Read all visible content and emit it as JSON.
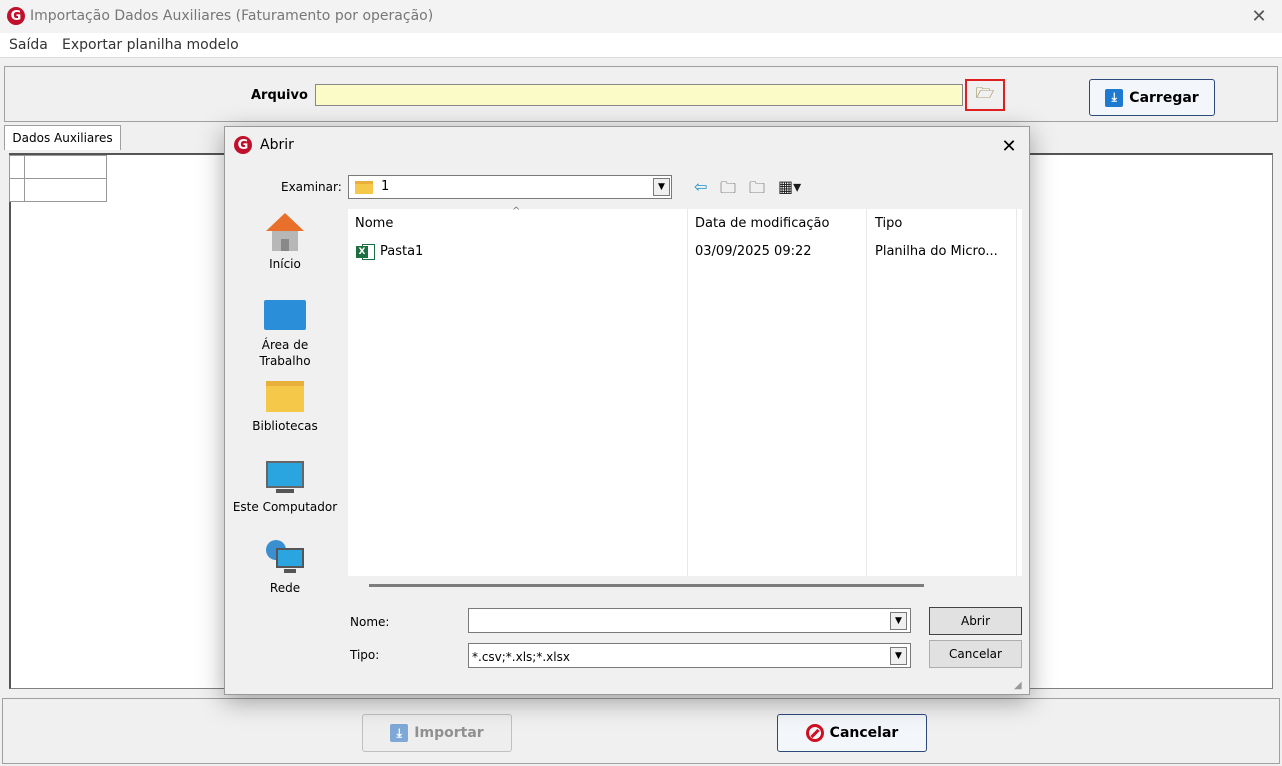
{
  "window": {
    "title": "Importação Dados Auxiliares (Faturamento por operação)",
    "logo_letter": "G",
    "close_glyph": "✕"
  },
  "menu": {
    "items": [
      "Saída",
      "Exportar planilha modelo"
    ]
  },
  "top": {
    "arquivo_label": "Arquivo",
    "arquivo_value": "",
    "browse_icon": "folder-open-icon",
    "carregar_label": "Carregar"
  },
  "tabs": {
    "dados_auxiliares": "Dados Auxiliares"
  },
  "bottom": {
    "importar_label": "Importar",
    "cancelar_label": "Cancelar"
  },
  "dialog": {
    "title": "Abrir",
    "examinar_label": "Examinar:",
    "examinar_value": "1",
    "places": [
      {
        "label": "Início",
        "icon": "home-icon"
      },
      {
        "label": "Área de\nTrabalho",
        "icon": "desktop-icon"
      },
      {
        "label": "Bibliotecas",
        "icon": "libraries-icon"
      },
      {
        "label": "Este Computador",
        "icon": "computer-icon"
      },
      {
        "label": "Rede",
        "icon": "network-icon"
      }
    ],
    "columns": [
      "Nome",
      "Data de modificação",
      "Tipo"
    ],
    "files": [
      {
        "name": "Pasta1",
        "modified": "03/09/2025 09:22",
        "type": "Planilha do Micro..."
      }
    ],
    "nome_label": "Nome:",
    "nome_value": "",
    "tipo_label": "Tipo:",
    "tipo_value": "*.csv;*.xls;*.xlsx",
    "abrir_label": "Abrir",
    "cancelar_label": "Cancelar"
  },
  "colors": {
    "input_bg": "#fbfbc7",
    "highlight_border": "#e02020",
    "logo_red": "#c0102b",
    "button_blue": "#1e7ad0"
  }
}
